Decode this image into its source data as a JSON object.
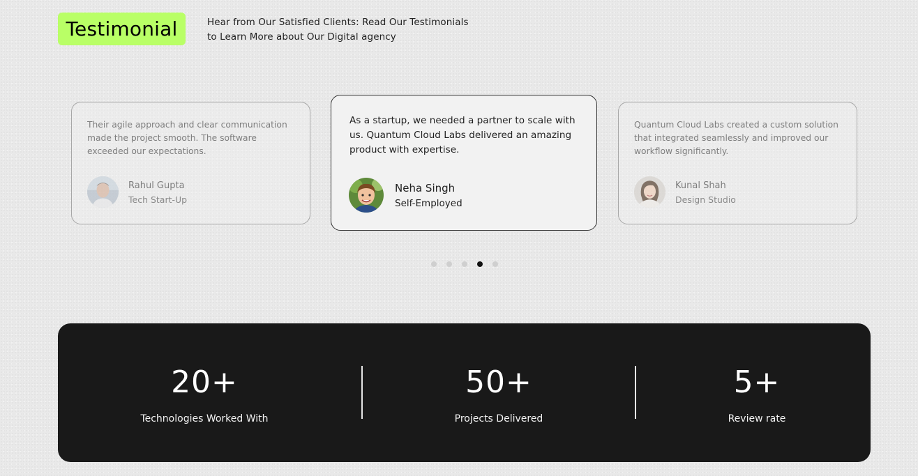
{
  "header": {
    "title": "Testimonial",
    "subtitle_line1": "Hear from Our Satisfied Clients: Read Our Testimonials",
    "subtitle_line2": "to Learn More about Our Digital agency",
    "accent_color": "#b9ff66"
  },
  "testimonials": [
    {
      "quote": "Their agile approach and clear communication made the project smooth. The software exceeded our expectations.",
      "name": "Rahul Gupta",
      "role": "Tech Start-Up",
      "avatar_icon": "man-portrait-avatar"
    },
    {
      "quote": "As a startup, we needed a partner to scale with us. Quantum Cloud Labs delivered an amazing product with expertise.",
      "name": "Neha Singh",
      "role": "Self-Employed",
      "avatar_icon": "boy-portrait-avatar"
    },
    {
      "quote": "Quantum Cloud Labs created a custom solution that integrated seamlessly and improved our workflow significantly.",
      "name": "Kunal Shah",
      "role": "Design Studio",
      "avatar_icon": "woman-portrait-avatar"
    }
  ],
  "carousel": {
    "dot_count": 5,
    "active_index": 3
  },
  "stats": [
    {
      "value": "20+",
      "label": "Technologies Worked With"
    },
    {
      "value": "50+",
      "label": "Projects Delivered"
    },
    {
      "value": "5+",
      "label": "Review rate"
    }
  ]
}
